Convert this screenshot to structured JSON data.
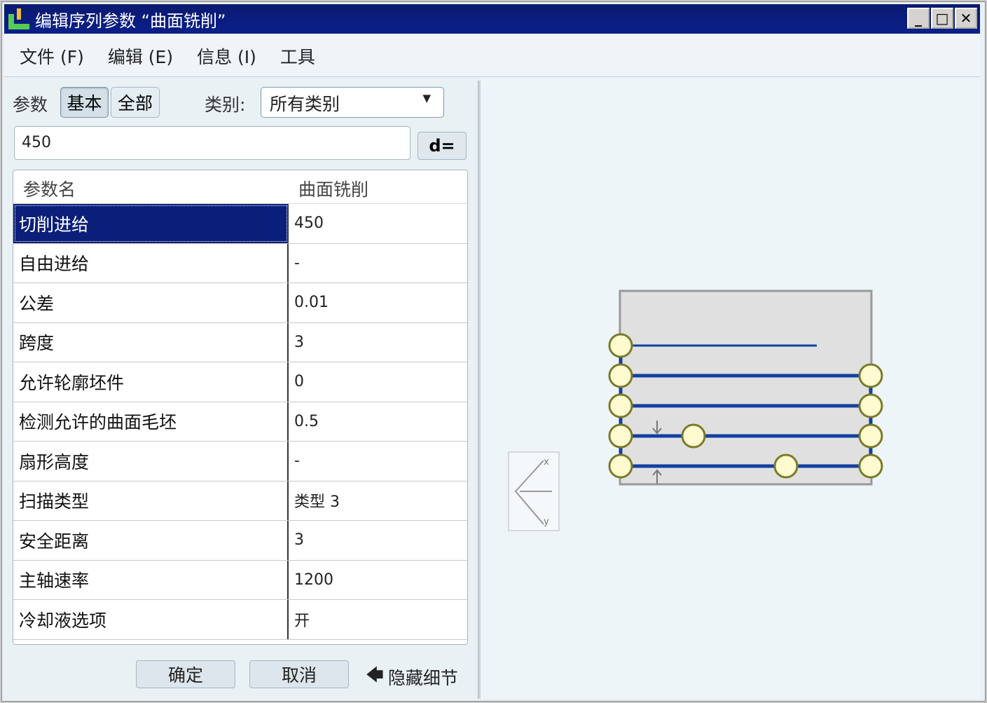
{
  "window": {
    "title": "编辑序列参数 “曲面铣削”",
    "min": "_",
    "max": "□",
    "close": "✕"
  },
  "menu": [
    "文件 (F)",
    "编辑 (E)",
    "信息 (I)",
    "工具"
  ],
  "toolbar": {
    "params_label": "参数",
    "basic": "基本",
    "all": "全部",
    "category_label": "类别:",
    "category_value": "所有类别"
  },
  "value_input": "450",
  "d_button": "d=",
  "table": {
    "headers": [
      "参数名",
      "曲面铣削"
    ],
    "rows": [
      [
        "切削进给",
        "450"
      ],
      [
        "自由进给",
        "-"
      ],
      [
        "公差",
        "0.01"
      ],
      [
        "跨度",
        "3"
      ],
      [
        "允许轮廓坯件",
        "0"
      ],
      [
        "检测允许的曲面毛坯",
        "0.5"
      ],
      [
        "扇形高度",
        "-"
      ],
      [
        "扫描类型",
        "类型 3"
      ],
      [
        "安全距离",
        "3"
      ],
      [
        "主轴速率",
        "1200"
      ],
      [
        "冷却液选项",
        "开"
      ]
    ]
  },
  "buttons": {
    "ok": "确定",
    "cancel": "取消",
    "hide_details": "隐藏细节"
  },
  "preview": {
    "axis_x": "x",
    "axis_y": "y"
  }
}
